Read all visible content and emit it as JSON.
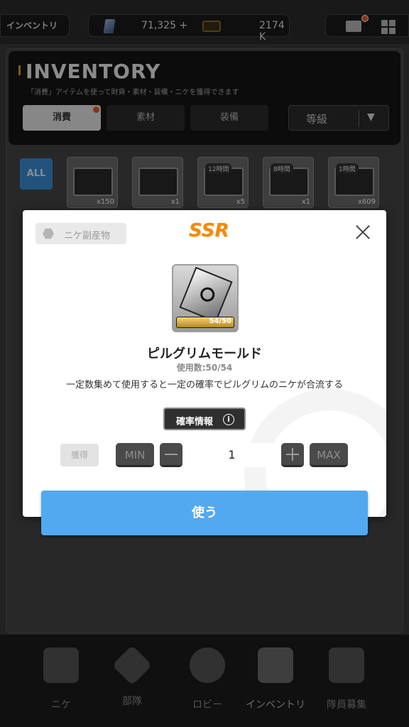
{
  "topbar": {
    "inventory_label": "インベントリ",
    "gems": "71,325",
    "gems_plus": "+",
    "credits": "2174 K"
  },
  "inventory": {
    "title": "INVENTORY",
    "subtitle": "「消費」アイテムを使って財貨・素材・装備・ニケを獲得できます",
    "tabs": [
      {
        "label": "消費"
      },
      {
        "label": "素材"
      },
      {
        "label": "装備"
      }
    ],
    "sort_label": "等級",
    "filter_all": "ALL",
    "items": [
      {
        "tag": "",
        "count": "x150"
      },
      {
        "tag": "",
        "count": "x1"
      },
      {
        "tag": "12時間",
        "count": "x5"
      },
      {
        "tag": "8時間",
        "count": "x1"
      },
      {
        "tag": "1時間",
        "count": "x609"
      }
    ]
  },
  "modal": {
    "category": "ニケ副産物",
    "rarity": "SSR",
    "item_name": "ピルグリムモールド",
    "usage": "使用数:50/54",
    "progress_label": "54/50",
    "progress_fraction": 1.0,
    "description": "一定数集めて使用すると一定の確率でピルグリムのニケが合流する",
    "prob_button": "確率情報",
    "info_glyph": "i",
    "gain_label": "獲得",
    "min_label": "MIN",
    "max_label": "MAX",
    "quantity": "1",
    "use_button": "使う",
    "accent_color": "#52a9ef",
    "rarity_color": "#f08a12"
  },
  "bottom_nav": [
    {
      "label": "ニケ",
      "icon": "users-icon"
    },
    {
      "label": "部隊",
      "icon": "squad-icon"
    },
    {
      "label": "ロビー",
      "icon": "lobby-icon"
    },
    {
      "label": "インベントリ",
      "icon": "backpack-icon"
    },
    {
      "label": "隊員募集",
      "icon": "recruit-icon"
    }
  ]
}
